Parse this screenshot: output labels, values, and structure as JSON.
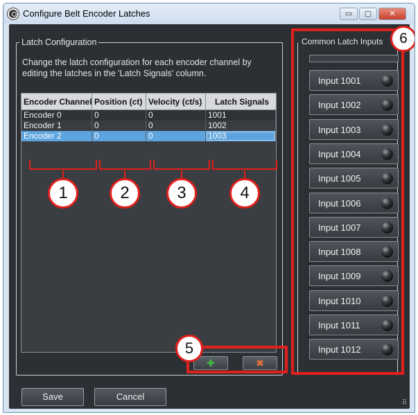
{
  "window": {
    "title": "Configure Belt Encoder Latches",
    "minimize_glyph": "▭",
    "maximize_glyph": "▢",
    "close_glyph": "✕"
  },
  "latch_config": {
    "group_title": "Latch Configuration",
    "description": "Change the latch configuration for each encoder channel by editing the latches in the 'Latch Signals' column.",
    "columns": [
      "Encoder Channel",
      "Position (ct)",
      "Velocity (ct/s)",
      "Latch Signals"
    ],
    "rows": [
      [
        "Encoder 0",
        "0",
        "0",
        "1001"
      ],
      [
        "Encoder 1",
        "0",
        "0",
        "1002"
      ],
      [
        "Encoder 2",
        "0",
        "0",
        "1003"
      ]
    ],
    "selected_row": 2,
    "add_glyph": "✚",
    "remove_glyph": "✖"
  },
  "common_inputs": {
    "group_title": "Common Latch Inputs",
    "inputs": [
      "Input 1001",
      "Input 1002",
      "Input 1003",
      "Input 1004",
      "Input 1005",
      "Input 1006",
      "Input 1007",
      "Input 1008",
      "Input 1009",
      "Input 1010",
      "Input 1011",
      "Input 1012"
    ]
  },
  "footer": {
    "save_label": "Save",
    "cancel_label": "Cancel",
    "grip_glyph": "⠿"
  },
  "callouts": [
    "1",
    "2",
    "3",
    "4",
    "5",
    "6"
  ],
  "colors": {
    "annotation_red": "#e0201c",
    "selection_blue": "#5ea4de",
    "panel_dark": "#2c2f33",
    "add_green": "#3fbf3f",
    "remove_orange": "#e8703a"
  }
}
